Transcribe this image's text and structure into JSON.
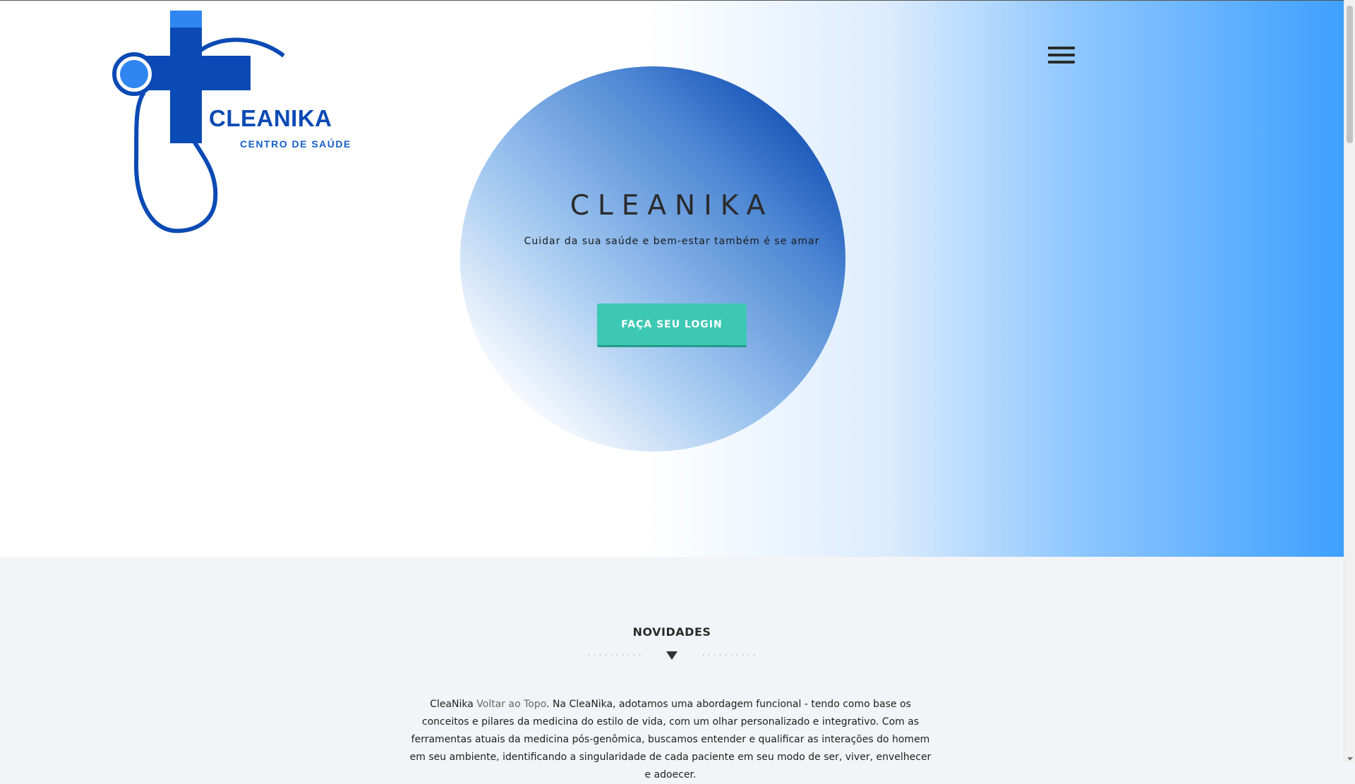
{
  "brand": {
    "logo_title": "CLEANIKA",
    "logo_subtitle": "CENTRO DE SAÚDE",
    "icon": "medical-cross-stethoscope-logo"
  },
  "nav": {
    "menu_icon": "hamburger-menu-icon"
  },
  "hero": {
    "title": "CLEANIKA",
    "subtitle": "Cuidar da sua saúde e bem-estar também é se amar",
    "login_button": "FAÇA SEU LOGIN"
  },
  "news": {
    "title": "NOVIDADES",
    "text_start": "CleaNika ",
    "link": "Voltar ao Topo",
    "text_rest": ". Na CleaNika, adotamos uma abordagem funcional - tendo como base os conceitos e pilares da medicina do estilo de vida, com um olhar personalizado e integrativo. Com as ferramentas atuais da medicina pós-genômica, buscamos entender e qualificar as interações do homem em seu ambiente, identificando a singularidade de cada paciente em seu modo de ser, viver, envelhecer e adoecer."
  },
  "colors": {
    "brand_blue": "#0b4ab4",
    "accent_teal": "#3dc8b4",
    "hero_gradient_end": "#3ea0ff"
  }
}
